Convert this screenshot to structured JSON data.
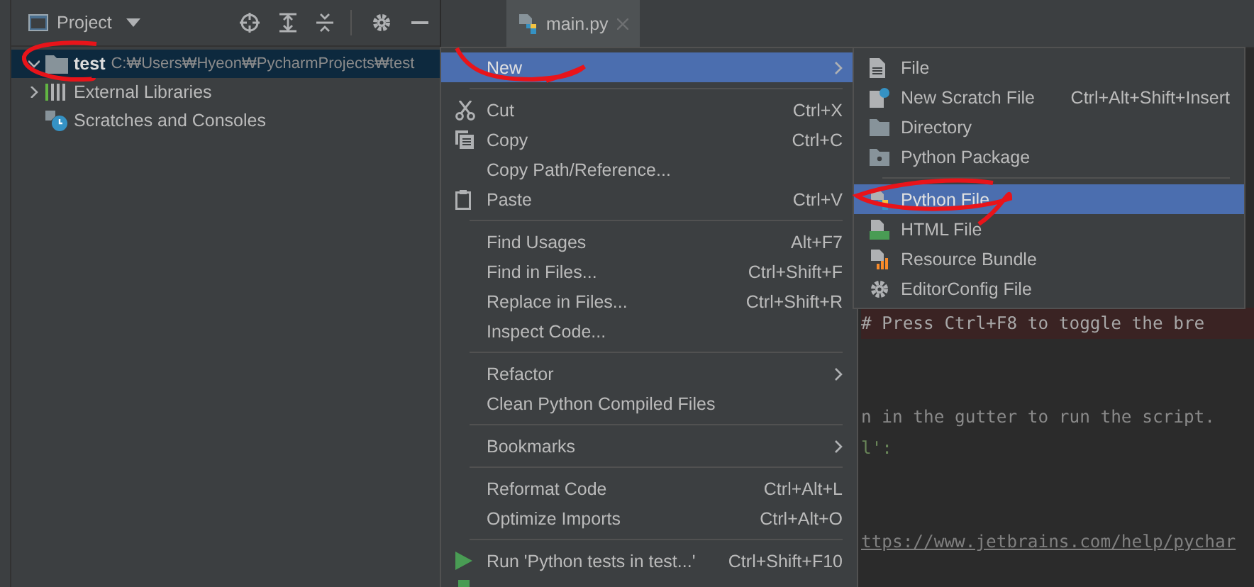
{
  "project_panel": {
    "title": "Project",
    "tree": [
      {
        "label": "test",
        "path": "C:₩Users₩Hyeon₩PycharmProjects₩test",
        "selected": true,
        "expanded": true,
        "kind": "folder"
      },
      {
        "label": "External Libraries",
        "selected": false,
        "expanded": false,
        "kind": "libraries"
      },
      {
        "label": "Scratches and Consoles",
        "selected": false,
        "kind": "scratches"
      }
    ]
  },
  "editor": {
    "tabs": [
      {
        "label": "main.py",
        "selected": true
      }
    ],
    "lines": [
      {
        "text": "# Press Ctrl+F8 to toggle the bre",
        "breakpoint": true,
        "kind": "comment"
      },
      {
        "breakpoint": false
      },
      {
        "breakpoint": false
      },
      {
        "text": "n in the gutter to run the script.",
        "breakpoint": false,
        "kind": "comment"
      },
      {
        "text": "l':",
        "breakpoint": false,
        "kind": "string"
      },
      {
        "breakpoint": false
      },
      {
        "breakpoint": false
      },
      {
        "text": "ttps://www.jetbrains.com/help/pychar",
        "breakpoint": false,
        "kind": "link"
      }
    ]
  },
  "context_menu": {
    "items": [
      {
        "kind": "item",
        "label": "New",
        "submenu": true,
        "selected": true
      },
      {
        "kind": "separator"
      },
      {
        "kind": "item",
        "label": "Cut",
        "shortcut": "Ctrl+X",
        "selected": false
      },
      {
        "kind": "item",
        "label": "Copy",
        "shortcut": "Ctrl+C",
        "selected": false
      },
      {
        "kind": "item",
        "label": "Copy Path/Reference...",
        "selected": false
      },
      {
        "kind": "item",
        "label": "Paste",
        "shortcut": "Ctrl+V",
        "selected": false
      },
      {
        "kind": "separator"
      },
      {
        "kind": "item",
        "label": "Find Usages",
        "shortcut": "Alt+F7",
        "selected": false
      },
      {
        "kind": "item",
        "label": "Find in Files...",
        "shortcut": "Ctrl+Shift+F",
        "selected": false
      },
      {
        "kind": "item",
        "label": "Replace in Files...",
        "shortcut": "Ctrl+Shift+R",
        "selected": false
      },
      {
        "kind": "item",
        "label": "Inspect Code...",
        "selected": false
      },
      {
        "kind": "separator"
      },
      {
        "kind": "item",
        "label": "Refactor",
        "submenu": true,
        "selected": false
      },
      {
        "kind": "item",
        "label": "Clean Python Compiled Files",
        "selected": false
      },
      {
        "kind": "separator"
      },
      {
        "kind": "item",
        "label": "Bookmarks",
        "submenu": true,
        "selected": false
      },
      {
        "kind": "separator"
      },
      {
        "kind": "item",
        "label": "Reformat Code",
        "shortcut": "Ctrl+Alt+L",
        "selected": false
      },
      {
        "kind": "item",
        "label": "Optimize Imports",
        "shortcut": "Ctrl+Alt+O",
        "selected": false
      },
      {
        "kind": "separator"
      },
      {
        "kind": "item",
        "label": "Run 'Python tests in test...'",
        "shortcut": "Ctrl+Shift+F10",
        "selected": false
      }
    ]
  },
  "new_submenu": {
    "items": [
      {
        "kind": "item",
        "label": "File",
        "selected": false
      },
      {
        "kind": "item",
        "label": "New Scratch File",
        "shortcut": "Ctrl+Alt+Shift+Insert",
        "selected": false
      },
      {
        "kind": "item",
        "label": "Directory",
        "selected": false
      },
      {
        "kind": "item",
        "label": "Python Package",
        "selected": false
      },
      {
        "kind": "separator"
      },
      {
        "kind": "item",
        "label": "Python File",
        "selected": true
      },
      {
        "kind": "item",
        "label": "HTML File",
        "selected": false
      },
      {
        "kind": "item",
        "label": "Resource Bundle",
        "selected": false
      },
      {
        "kind": "item",
        "label": "EditorConfig File",
        "selected": false
      }
    ]
  }
}
